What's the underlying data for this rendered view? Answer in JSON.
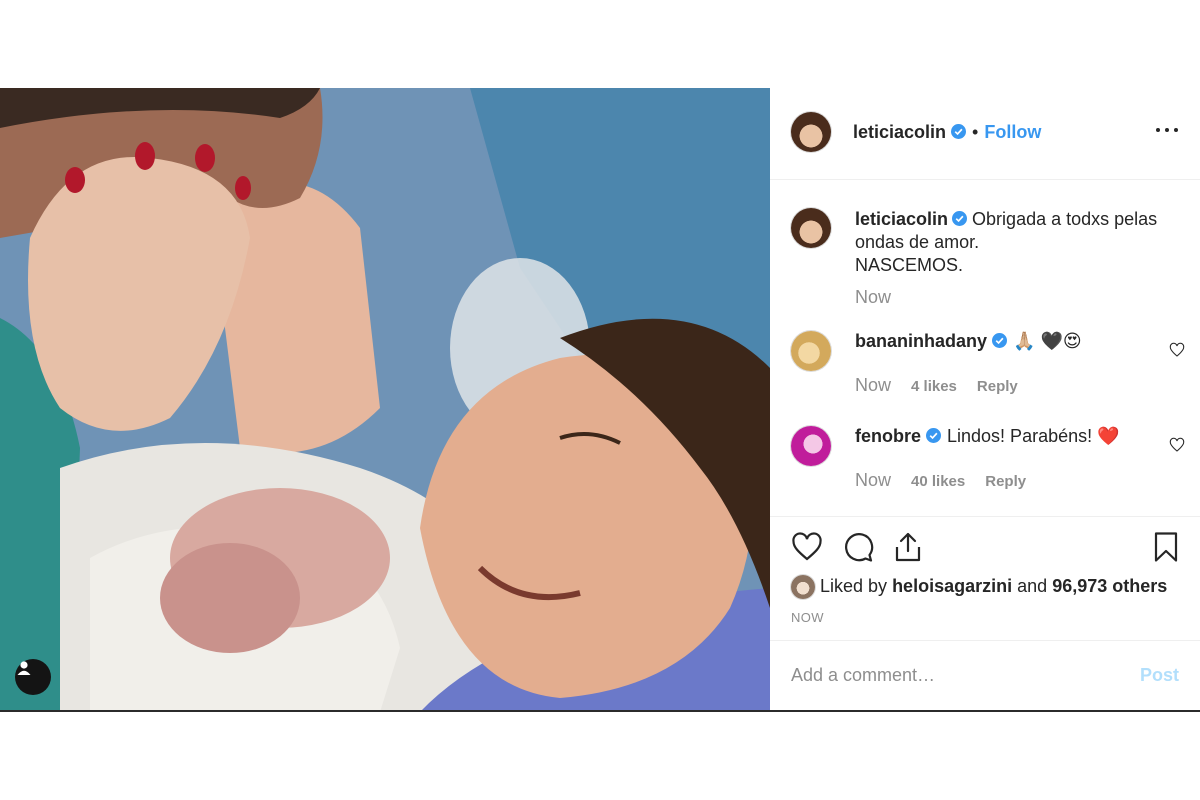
{
  "post": {
    "author": "leticiacolin",
    "follow_label": "Follow",
    "caption_lines": [
      "Obrigada a todxs pelas ondas de amor.",
      "NASCEMOS."
    ],
    "caption_time": "Now",
    "likes_prefix": "Liked by",
    "liked_by_user": "heloisagarzini",
    "likes_and": "and",
    "likes_others": "96,973 others",
    "timestamp": "NOW"
  },
  "comments": [
    {
      "user": "bananinhadany",
      "text": "🙏🏼 🖤😍",
      "time": "Now",
      "likes": "4 likes",
      "reply": "Reply"
    },
    {
      "user": "fenobre",
      "text": "Lindos! Parabéns! ❤️",
      "time": "Now",
      "likes": "40 likes",
      "reply": "Reply"
    }
  ],
  "add_comment": {
    "placeholder": "Add a comment…",
    "post_label": "Post"
  },
  "icons": [
    "verified-icon",
    "more-icon",
    "heart-icon",
    "comment-icon",
    "share-icon",
    "bookmark-icon",
    "user-tag-icon"
  ],
  "colors": {
    "accent": "#3897f0",
    "verified": "#3897f0",
    "muted": "#8e8e8e",
    "post_disabled": "#b2dffc"
  }
}
